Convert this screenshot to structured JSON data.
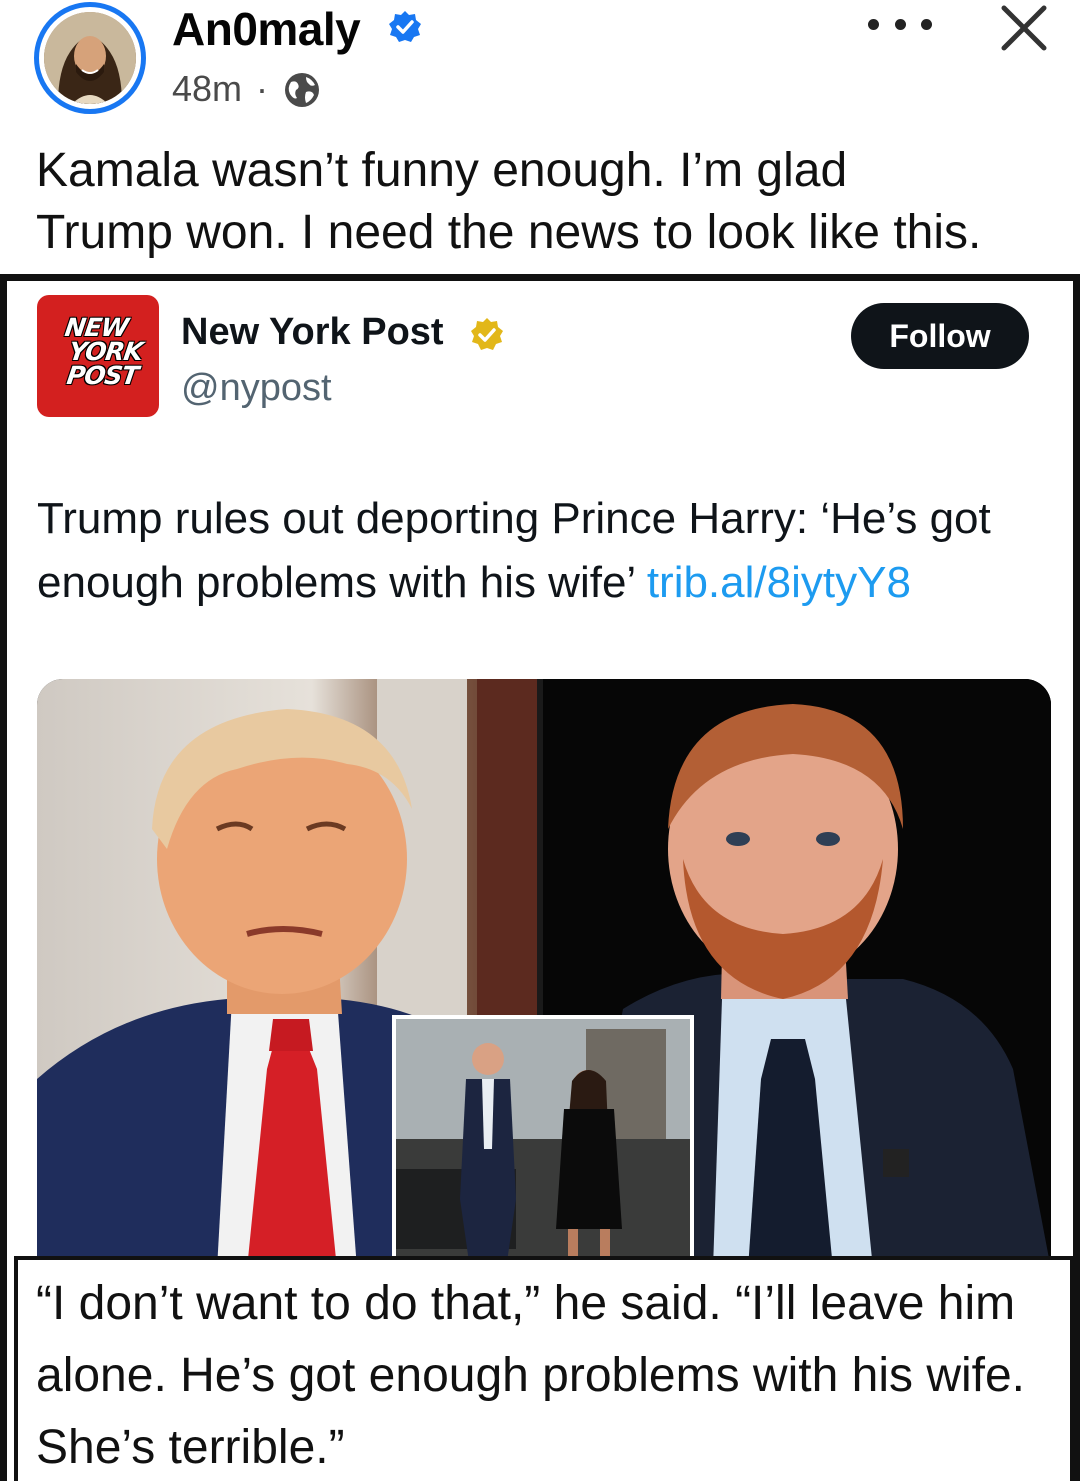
{
  "fb_post": {
    "author_name": "An0maly",
    "timestamp": "48m",
    "separator": "·",
    "caption_line1": "Kamala wasn’t funny enough. I’m glad",
    "caption_line2": "Trump won. I need the news to look like this."
  },
  "tweet": {
    "logo_lines": [
      "NEW",
      "YORK",
      "POST"
    ],
    "account_name": "New York Post",
    "handle": "@nypost",
    "follow_label": "Follow",
    "body_text": "Trump rules out deporting Prince Harry: ‘He’s got enough problems with his wife’",
    "link_text": "trib.al/8iytyY8"
  },
  "quote": {
    "text": "“I don’t want to do that,” he said. “I’ll leave him alone. He’s got enough problems with his wife. She’s terrible.”"
  },
  "colors": {
    "facebook_blue": "#1877f2",
    "link_blue": "#1d9bf0",
    "nypost_red": "#d3201f",
    "gold_badge": "#e2b719",
    "follow_button": "#0f1419"
  },
  "icons": [
    "verified-badge-icon",
    "globe-icon",
    "more-options-icon",
    "close-icon",
    "gold-verified-badge-icon"
  ]
}
